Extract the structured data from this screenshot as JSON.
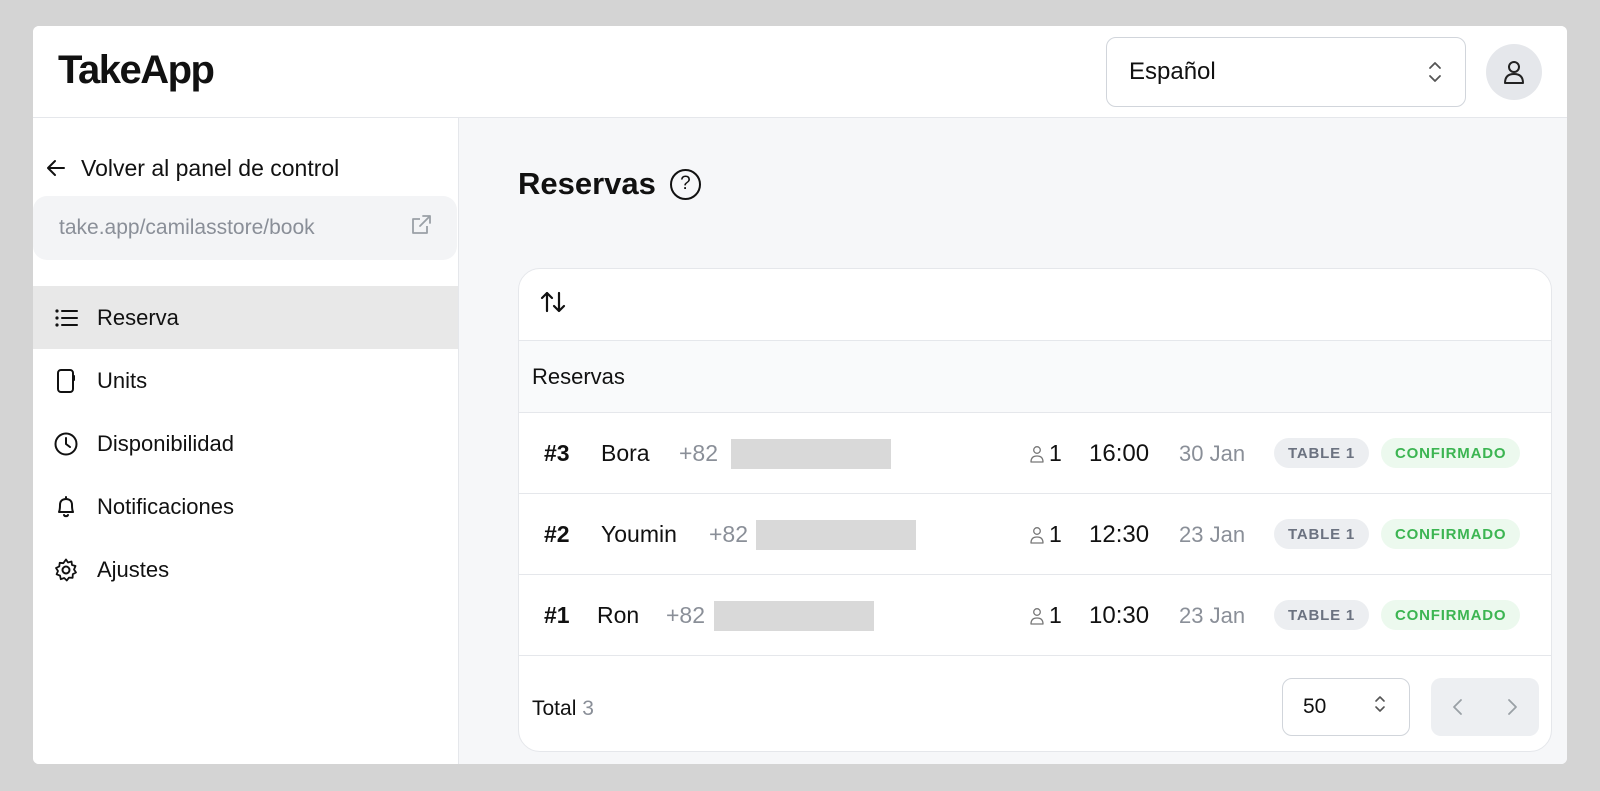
{
  "app": {
    "logo": "TakeApp"
  },
  "header": {
    "language": "Español"
  },
  "sidebar": {
    "back_label": "Volver al panel de control",
    "store_url": "take.app/camilasstore/book",
    "items": [
      {
        "label": "Reserva",
        "icon": "list-icon",
        "active": true
      },
      {
        "label": "Units",
        "icon": "device-icon",
        "active": false
      },
      {
        "label": "Disponibilidad",
        "icon": "clock-icon",
        "active": false
      },
      {
        "label": "Notificaciones",
        "icon": "bell-icon",
        "active": false
      },
      {
        "label": "Ajustes",
        "icon": "gear-icon",
        "active": false
      }
    ]
  },
  "main": {
    "title": "Reservas",
    "help_symbol": "?",
    "section_label": "Reservas",
    "rows": [
      {
        "number": "#3",
        "name": "Bora",
        "phone_prefix": "+82",
        "guests": "1",
        "time": "16:00",
        "date": "30 Jan",
        "table": "TABLE 1",
        "status": "CONFIRMADO"
      },
      {
        "number": "#2",
        "name": "Youmin",
        "phone_prefix": "+82",
        "guests": "1",
        "time": "12:30",
        "date": "23 Jan",
        "table": "TABLE 1",
        "status": "CONFIRMADO"
      },
      {
        "number": "#1",
        "name": "Ron",
        "phone_prefix": "+82",
        "guests": "1",
        "time": "10:30",
        "date": "23 Jan",
        "table": "TABLE 1",
        "status": "CONFIRMADO"
      }
    ],
    "footer": {
      "total_label": "Total",
      "total_count": "3",
      "page_size": "50"
    }
  },
  "colors": {
    "status_green": "#3cb552",
    "active_nav_bg": "#e8e8e8",
    "muted_text": "#8a8f98"
  }
}
